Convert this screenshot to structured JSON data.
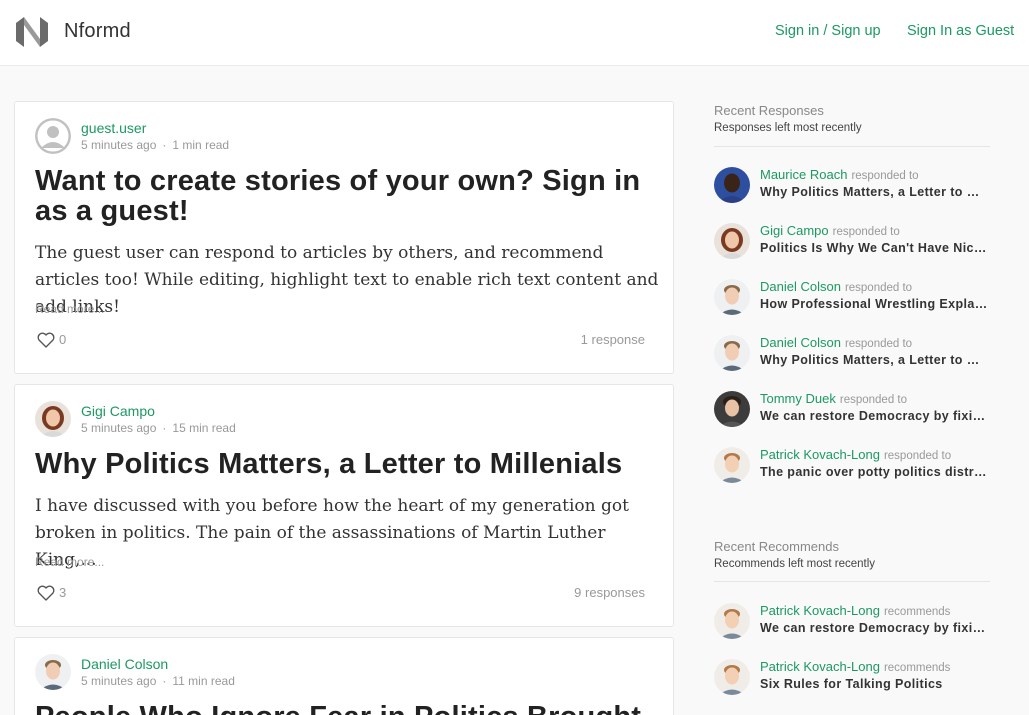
{
  "header": {
    "brand": "Nformd",
    "sign_in_label": "Sign in / Sign up",
    "guest_label": "Sign In as Guest",
    "accent": "#1c9963"
  },
  "posts": [
    {
      "author": "guest.user",
      "time": "5 minutes ago",
      "read": "1 min read",
      "title": "Want to create stories of your own? Sign in as a guest!",
      "excerpt": "The guest user can respond to articles by others, and recommend articles too! While editing, highlight text to enable rich text content and add links!",
      "read_more": "Read more...",
      "likes": "0",
      "responses": "1 response"
    },
    {
      "author": "Gigi Campo",
      "time": "5 minutes ago",
      "read": "15 min read",
      "title": "Why Politics Matters, a Letter to Millenials",
      "excerpt": "I have discussed with you before how the heart of my generation got broken in politics. The pain of the assassinations of Martin Luther King,...",
      "read_more": "Read more...",
      "likes": "3",
      "responses": "9 responses"
    },
    {
      "author": "Daniel Colson",
      "time": "5 minutes ago",
      "read": "11 min read",
      "title": "People Who Ignore Fear in Politics Brought"
    }
  ],
  "sidebar": {
    "responses_title": "Recent Responses",
    "responses_sub": "Responses left most recently",
    "responses": [
      {
        "name": "Maurice Roach",
        "verb": "responded to",
        "article": "Why Politics Matters, a Letter to Millenials"
      },
      {
        "name": "Gigi Campo",
        "verb": "responded to",
        "article": "Politics Is Why We Can't Have Nice Things"
      },
      {
        "name": "Daniel Colson",
        "verb": "responded to",
        "article": "How Professional Wrestling Explains Politics"
      },
      {
        "name": "Daniel Colson",
        "verb": "responded to",
        "article": "Why Politics Matters, a Letter to Millenials"
      },
      {
        "name": "Tommy Duek",
        "verb": "responded to",
        "article": "We can restore Democracy by fixing politics"
      },
      {
        "name": "Patrick Kovach-Long",
        "verb": "responded to",
        "article": "The panic over potty politics distracts"
      }
    ],
    "recommends_title": "Recent Recommends",
    "recommends_sub": "Recommends left most recently",
    "recommends": [
      {
        "name": "Patrick Kovach-Long",
        "verb": "recommends",
        "article": "We can restore Democracy by fixing politics"
      },
      {
        "name": "Patrick Kovach-Long",
        "verb": "recommends",
        "article": "Six Rules for Talking Politics"
      }
    ]
  }
}
